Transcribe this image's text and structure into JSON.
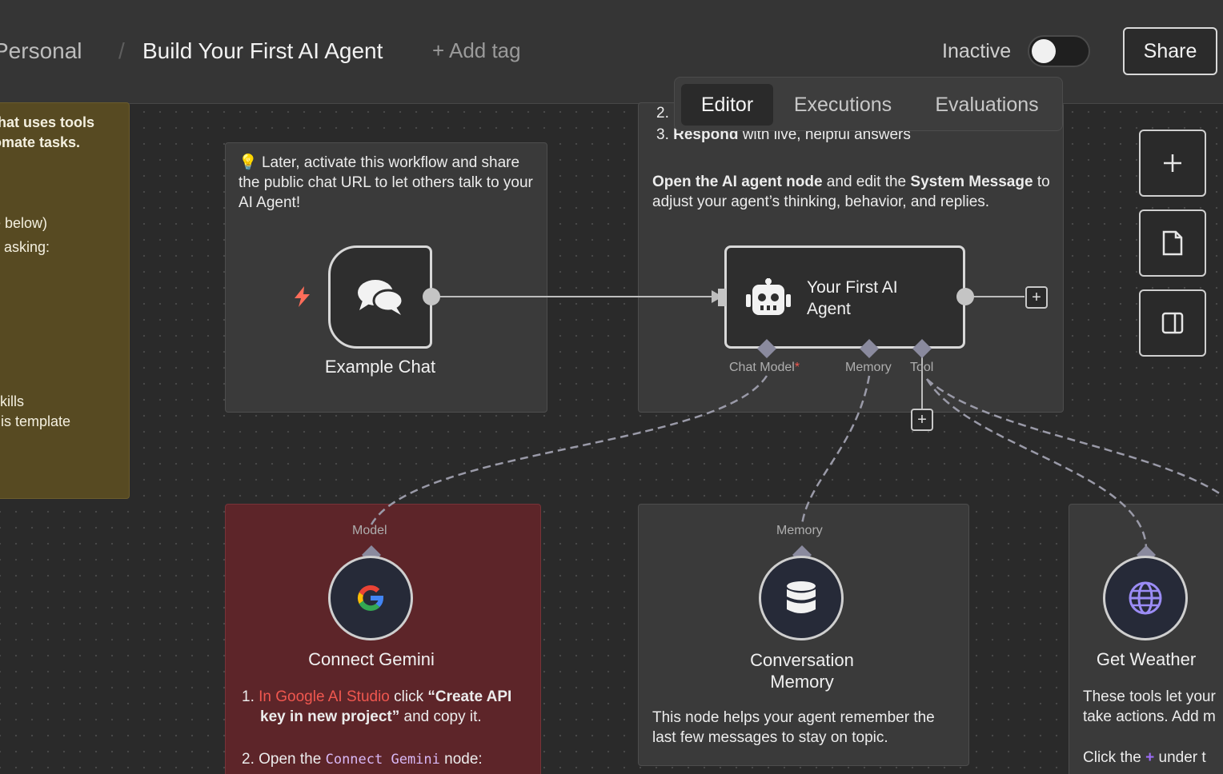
{
  "header": {
    "breadcrumb_personal": "Personal",
    "breadcrumb_sep": "/",
    "workflow_title": "Build Your First AI Agent",
    "add_tag": "+ Add tag",
    "status_label": "Inactive",
    "share_label": "Share"
  },
  "tabs": [
    {
      "label": "Editor",
      "active": true
    },
    {
      "label": "Executions",
      "active": false
    },
    {
      "label": "Evaluations",
      "active": false
    }
  ],
  "sticky_yellow": {
    "line1": "that uses tools",
    "line2": "omate tasks.",
    "line3": "e below)",
    "line4": "y asking:",
    "line5": " skills",
    "line6": "nis template"
  },
  "sticky_chat": {
    "icon": "lightbulb-icon",
    "text": "Later, activate this workflow and share the public chat URL to let others talk to your AI Agent!"
  },
  "sticky_agent": {
    "item2": "2.",
    "item3_bold": "Respond",
    "item3_rest": " with live, helpful answers",
    "item3_num": "3.",
    "para_bold1": "Open the AI agent node",
    "para_mid": " and edit the ",
    "para_bold2": "System Message",
    "para_rest": " to adjust your agent’s thinking, behavior, and replies."
  },
  "nodes": {
    "chat": {
      "label": "Example Chat",
      "icon": "chat-bubbles-icon",
      "trigger_icon": "lightning-icon"
    },
    "agent": {
      "label_line1": "Your First AI",
      "label_line2": "Agent",
      "icon": "robot-icon",
      "ports": {
        "chat_model": "Chat Model",
        "required_mark": "*",
        "memory": "Memory",
        "tool": "Tool"
      }
    },
    "gemini": {
      "label": "Connect Gemini",
      "port": "Model",
      "icon": "google-icon"
    },
    "memory": {
      "label_line1": "Conversation",
      "label_line2": "Memory",
      "port": "Memory",
      "icon": "database-icon"
    },
    "weather": {
      "label": "Get Weather",
      "icon": "globe-icon"
    }
  },
  "sticky_gemini": {
    "n1": "1.",
    "link": "In Google AI Studio",
    "t1": " click ",
    "bold1": "“Create API",
    "bold2": "key in new project”",
    "t2": " and copy it.",
    "n2": "2.",
    "t3": "Open the ",
    "code": "Connect Gemini",
    "t4": " node:"
  },
  "sticky_memory": {
    "text": "This node helps your agent remember the last few messages to stay on topic."
  },
  "sticky_weather": {
    "line1": "These tools let your",
    "line2": "take actions. Add m",
    "line3a": "Click the ",
    "line3b": " under t"
  },
  "colors": {
    "link_red": "#f0574f",
    "accent_purple": "#9b6cf5",
    "trigger_orange": "#ff6d5a"
  }
}
